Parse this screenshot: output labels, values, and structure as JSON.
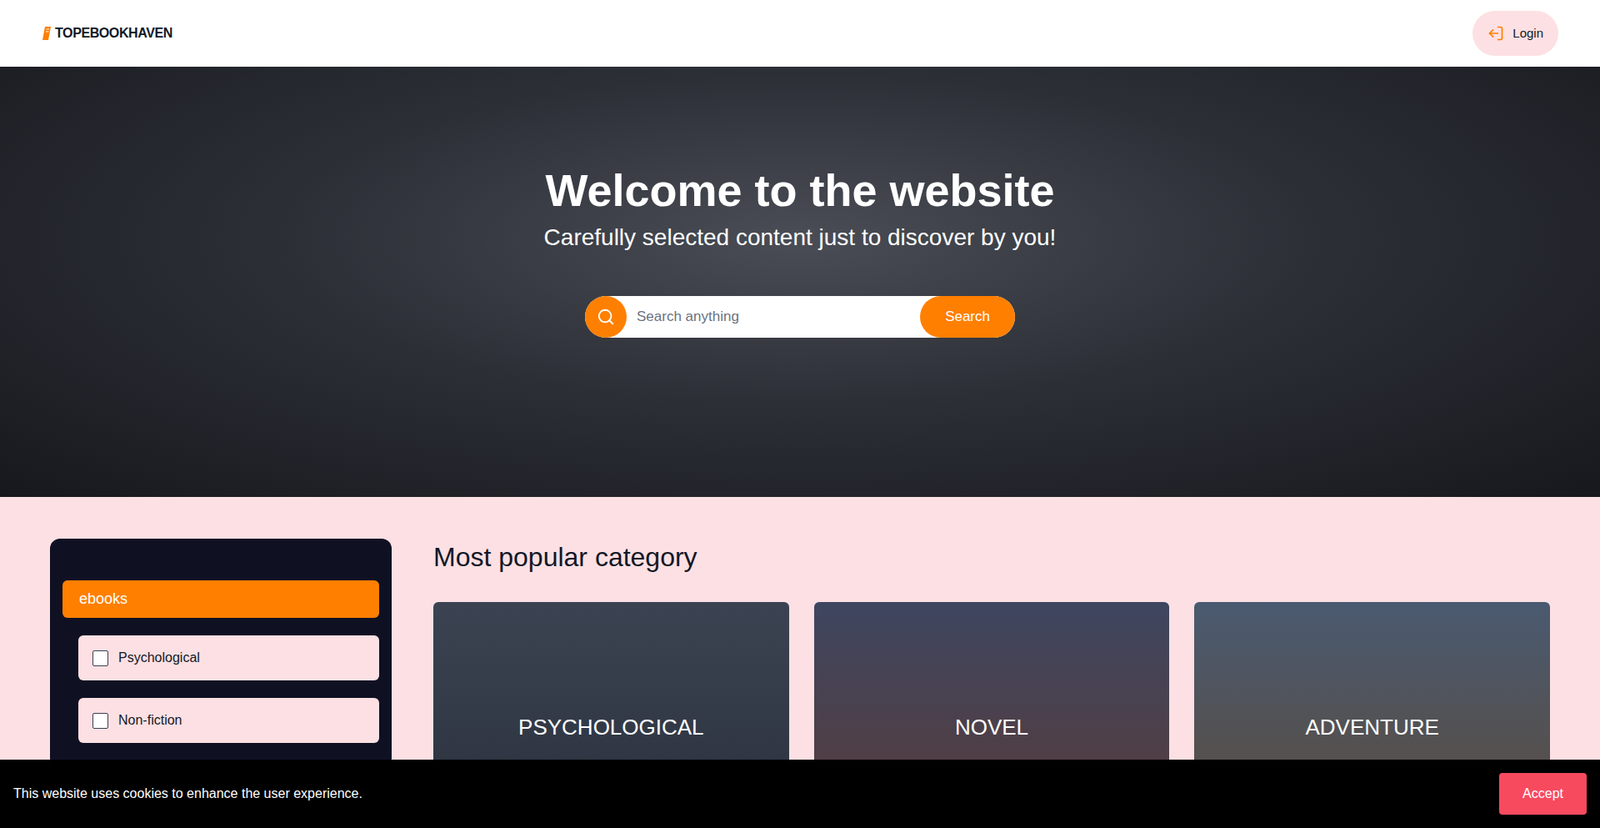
{
  "header": {
    "logo": "TOPEBOOKHAVEN",
    "login": "Login"
  },
  "hero": {
    "title": "Welcome to the website",
    "subtitle": "Carefully selected content just to discover by you!",
    "search": {
      "placeholder": "Search anything",
      "button": "Search"
    }
  },
  "sidebar": {
    "category": {
      "label": "ebooks",
      "selected": true
    },
    "items": [
      {
        "label": "Psychological",
        "checked": false
      },
      {
        "label": "Non-fiction",
        "checked": false
      }
    ]
  },
  "popular": {
    "title": "Most popular category",
    "cards": [
      {
        "label": "PSYCHOLOGICAL"
      },
      {
        "label": "NOVEL"
      },
      {
        "label": "ADVENTURE"
      }
    ]
  },
  "cookie_banner": {
    "text": "This website uses cookies to enhance the user experience.",
    "button": "Accept"
  }
}
